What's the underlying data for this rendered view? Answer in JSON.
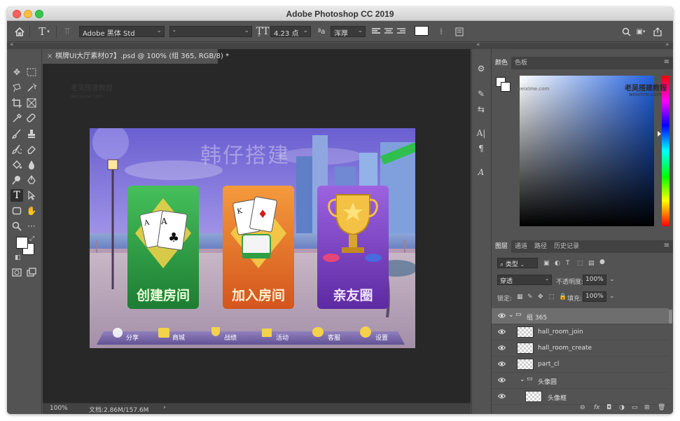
{
  "app": {
    "title": "Adobe Photoshop CC 2019"
  },
  "options": {
    "font_family": "Adobe 黑体 Std",
    "font_style": "-",
    "font_size": "4.23 点",
    "aa_icon_text": "ªa",
    "antialias": "浑厚"
  },
  "document": {
    "tab_title": "棋牌UI大厅素材07】.psd @ 100% (组 365, RGB/8) *",
    "zoom": "100%",
    "doc_size": "文档:2.86M/157.6M"
  },
  "artwork": {
    "watermark_title": "韩仔搭建",
    "cards": [
      "创建房间",
      "加入房间",
      "亲友圈"
    ],
    "bottom_nav": [
      "分享",
      "商城",
      "战绩",
      "活动",
      "客服",
      "设置"
    ],
    "watermark_small": "老吴搭建教程",
    "watermark_url": "weixlme.com"
  },
  "color_panel": {
    "tabs": [
      "颜色",
      "色板"
    ],
    "watermark": "老吴搭建教程",
    "watermark_url": "weixlme.com"
  },
  "layers_panel": {
    "tabs": [
      "图层",
      "通道",
      "路径",
      "历史记录"
    ],
    "filter_kind": "类型",
    "blend_mode": "穿透",
    "opacity_label": "不透明度:",
    "opacity": "100%",
    "lock_label": "锁定:",
    "fill_label": "填充:",
    "fill": "100%",
    "layers": [
      {
        "name": "组 365",
        "kind": "group",
        "selected": true
      },
      {
        "name": "hall_room_join",
        "kind": "layer"
      },
      {
        "name": "hall_room_create",
        "kind": "layer"
      },
      {
        "name": "part_cl",
        "kind": "layer"
      },
      {
        "name": "头像圆",
        "kind": "group"
      },
      {
        "name": "头像框",
        "kind": "layer"
      }
    ]
  },
  "colors": {
    "chrome": "#535353",
    "canvas_bg": "#282828",
    "card_green": "#2f9e45",
    "card_orange": "#e8732a",
    "card_purple": "#7a3fbf"
  }
}
